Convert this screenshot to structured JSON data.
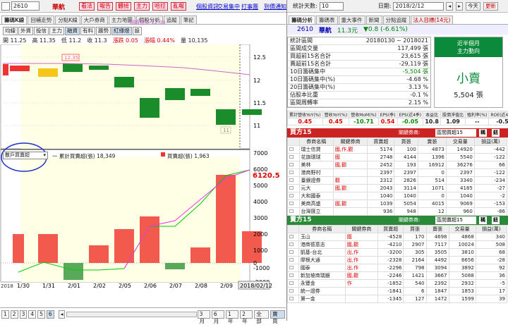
{
  "top": {
    "code": "2610",
    "name": "華航",
    "buttons": [
      "看法",
      "報告",
      "體檢",
      "主力",
      "哈拉",
      "亂報"
    ],
    "links": [
      "個股資訊",
      "交易集中",
      "打事團",
      "到價通知"
    ]
  },
  "left_tabs": [
    "籌碼K線",
    "回補走勢",
    "分點K線",
    "大戶券商",
    "主力地圖",
    "個股分析",
    "追蹤",
    "筆記"
  ],
  "left_buttons": [
    "均線",
    "外資",
    "投信",
    "主力",
    "融資",
    "有料",
    "趨勢",
    "紅綠燈",
    "設"
  ],
  "quote": {
    "open": "開 11.25",
    "high": "高 11.35",
    "low": "低 11.2",
    "close": "收 11.3",
    "change": "漲跌 0.05",
    "pct": "漲幅 0.44%",
    "volume": "量 10,135"
  },
  "cost_label": "融資成本 12.08",
  "price_axis": [
    "12.5",
    "12",
    "11.5",
    "11"
  ],
  "hover_price": "12.35",
  "low_marker": "11",
  "indicator": {
    "select": "散戶買賣超",
    "legend1": "一 累計買賣超(張) 18,349",
    "legend2": "買賣超(張) 1,963"
  },
  "vol_axis": [
    "7000",
    "6000",
    "5000",
    "4000",
    "3000",
    "2000",
    "1000",
    "0",
    "-1000",
    "-2000"
  ],
  "vol_current": "6120.5",
  "x_dates": [
    "1/30",
    "1/31",
    "2/01",
    "2/02",
    "2/05",
    "2/06",
    "2/07",
    "2/08",
    "2/09"
  ],
  "year_label": "2018",
  "cursor_date": "2018/02/12",
  "bottom_nav": {
    "pages": [
      "1",
      "2",
      "3",
      "4",
      "5",
      "6"
    ],
    "ranges": [
      "3月",
      "6月",
      "1年",
      "2年",
      "全部"
    ],
    "buy": "賣買"
  },
  "right_top": {
    "days_label": "統計天數:",
    "days_value": "10",
    "date_label": "日期:",
    "date_value": "2018/2/12",
    "today": "今天",
    "refresh": "更新"
  },
  "right_tabs": [
    "籌碼分析",
    "籌碼表",
    "重大事件",
    "新聞",
    "分點追蹤",
    "法人目標(14元)"
  ],
  "stock_head": {
    "code": "2610",
    "name": "華航",
    "price": "11.3元",
    "change": "▼0.8 (-6.61%)"
  },
  "stats": [
    {
      "k": "統計區間",
      "v": "20180130 ~ 2018021"
    },
    {
      "k": "區間成交量",
      "v": "117,499 張"
    },
    {
      "k": "買超前15名合計",
      "v": "23,615 張"
    },
    {
      "k": "賣超前15名合計",
      "v": "-29,119 張"
    },
    {
      "k": "10日籌碼集中",
      "v": "-5,504 張"
    },
    {
      "k": "10日籌碼集中(%)",
      "v": "-4.68 %"
    },
    {
      "k": "20日籌碼集中(%)",
      "v": "3.13 %"
    },
    {
      "k": "佔股本比重",
      "v": "-0.1 %"
    },
    {
      "k": "區間周轉率",
      "v": "2.15 %"
    }
  ],
  "side_box": {
    "t1": "近半個月",
    "t2": "主力動向",
    "big": "小賣",
    "amt": "5,504 張"
  },
  "fin_headers": [
    "累計營收YoY(%)",
    "營收YoY(%)",
    "營收MoM(%)",
    "EPS(季)",
    "EPS(近4季)",
    "本益比",
    "股價淨值比",
    "殖利率(%)",
    "ROE(近4季)"
  ],
  "fin_values": [
    "0.45",
    "0.45",
    "-10.71",
    "0.54",
    "-0.05",
    "10.8",
    "1.09",
    "--",
    "-0.5"
  ],
  "buy15": {
    "title": "買方15",
    "related": "關鍵券商:",
    "select": "區間買超15",
    "btn1": "稱",
    "btn2": "鈕",
    "headers": [
      "券商名稱",
      "關鍵券商",
      "買賣超",
      "買張",
      "賣張",
      "交易量",
      "損益(萬)"
    ],
    "rows": [
      [
        "瑞士信貸",
        "國,作,觀",
        "5174",
        "100",
        "4873",
        "14920",
        "-442"
      ],
      [
        "花旗環球",
        "國",
        "2748",
        "4144",
        "1396",
        "5540",
        "-122"
      ],
      [
        "美林",
        "國,觀",
        "2452",
        "193",
        "16912",
        "36276",
        "66"
      ],
      [
        "港商野村",
        "",
        "2397",
        "2397",
        "0",
        "2397",
        "-122"
      ],
      [
        "臺銀證券",
        "觀",
        "2312",
        "2826",
        "514",
        "3340",
        "-234"
      ],
      [
        "元大",
        "國,觀",
        "2043",
        "3114",
        "1071",
        "4185",
        "-27"
      ],
      [
        "大和國泰",
        "",
        "1040",
        "1040",
        "0",
        "1040",
        "-2"
      ],
      [
        "美商高盛",
        "國,觀",
        "1039",
        "5054",
        "4015",
        "9069",
        "-153"
      ],
      [
        "台灣匯立",
        "",
        "936",
        "948",
        "12",
        "960",
        "-86"
      ]
    ]
  },
  "sell15": {
    "title": "賣方15",
    "related": "關鍵券商:",
    "select": "區間賣超15",
    "btn1": "稱",
    "btn2": "鈕",
    "headers": [
      "券商名稱",
      "關鍵券商",
      "買賣超",
      "買張",
      "賣張",
      "交易量",
      "損益(萬)"
    ],
    "rows": [
      [
        "玉山",
        "國",
        "-4528",
        "170",
        "4698",
        "4868",
        "340"
      ],
      [
        "港商德意志",
        "國,觀",
        "-4210",
        "2907",
        "7117",
        "10024",
        "508"
      ],
      [
        "凱基-台北",
        "出,作",
        "-3200",
        "305",
        "3505",
        "3810",
        "68"
      ],
      [
        "摩根大通",
        "出,作",
        "-2328",
        "2164",
        "4492",
        "6656",
        "-28"
      ],
      [
        "國泰",
        "出,作",
        "-2296",
        "798",
        "3094",
        "3892",
        "92"
      ],
      [
        "新加坡商瑞銀",
        "國,觀",
        "-2246",
        "1421",
        "3667",
        "5088",
        "36"
      ],
      [
        "永豐金",
        "作",
        "-1852",
        "540",
        "2392",
        "2932",
        "-5"
      ],
      [
        "統一證券",
        "",
        "-1841",
        "6",
        "1847",
        "1853",
        "17"
      ],
      [
        "第一金",
        "",
        "-1345",
        "127",
        "1472",
        "1599",
        "39"
      ]
    ]
  }
}
